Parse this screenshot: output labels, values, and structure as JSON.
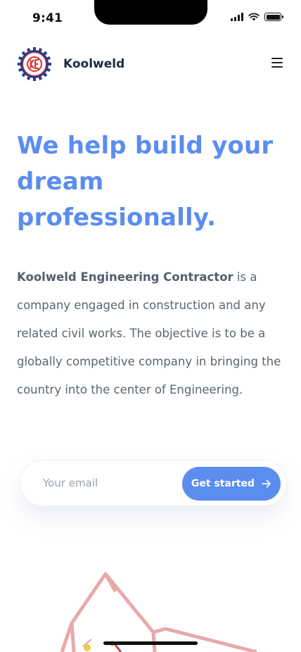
{
  "status_bar": {
    "time": "9:41",
    "icons": [
      "cellular-signal-icon",
      "wifi-icon",
      "battery-icon"
    ]
  },
  "header": {
    "brand_name": "Koolweld",
    "logo_icon": "koolweld-gear-logo",
    "menu_icon": "hamburger-menu-icon"
  },
  "hero": {
    "title_line1": "We help build your",
    "title_line2": "dream",
    "title_line3": "professionally.",
    "desc_bold": "Koolweld Engineering Contractor",
    "desc_rest": " is a company engaged in construction and any related civil works. The objective is to be a globally competitive company in bringing the country into the center of Engineering."
  },
  "form": {
    "email_placeholder": "Your email",
    "email_value": "",
    "cta_label": "Get started",
    "cta_icon": "arrow-right-icon"
  },
  "illustration": {
    "icon": "house-frame-illustration"
  },
  "colors": {
    "accent": "#5b8def",
    "text_body": "#5b6472",
    "brand_text": "#1f2a44",
    "logo_red": "#d62e2e",
    "logo_blue": "#2b3a8f",
    "house_frame": "#e8a9a9"
  }
}
